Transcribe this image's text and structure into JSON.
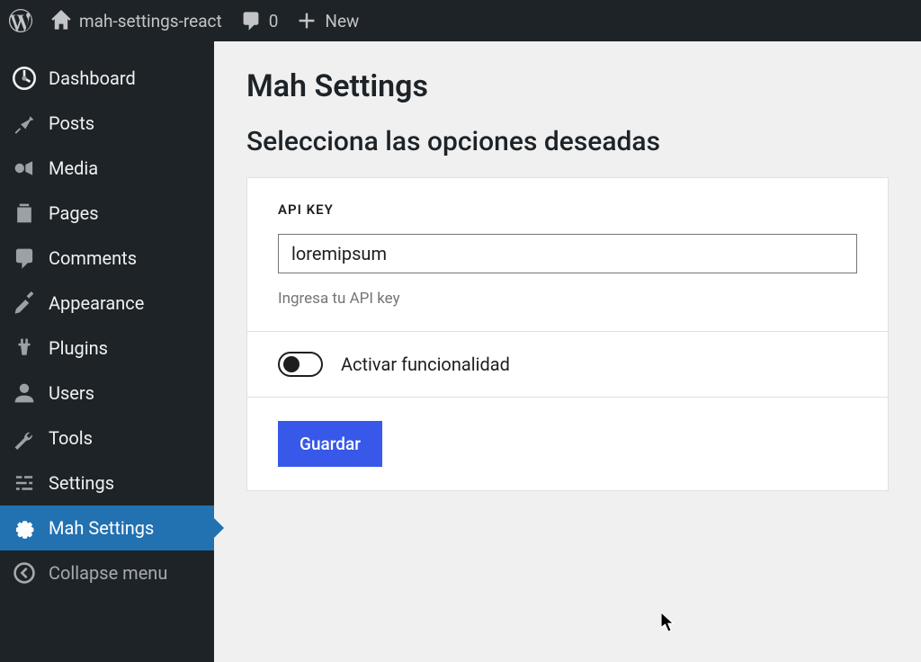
{
  "toolbar": {
    "site_name": "mah-settings-react",
    "comments_count": "0",
    "new_label": "New"
  },
  "sidebar": {
    "items": [
      {
        "label": "Dashboard",
        "icon": "dashboard"
      },
      {
        "label": "Posts",
        "icon": "pin"
      },
      {
        "label": "Media",
        "icon": "media"
      },
      {
        "label": "Pages",
        "icon": "pages"
      },
      {
        "label": "Comments",
        "icon": "comment"
      },
      {
        "label": "Appearance",
        "icon": "brush"
      },
      {
        "label": "Plugins",
        "icon": "plugin"
      },
      {
        "label": "Users",
        "icon": "user"
      },
      {
        "label": "Tools",
        "icon": "wrench"
      },
      {
        "label": "Settings",
        "icon": "sliders"
      },
      {
        "label": "Mah Settings",
        "icon": "gear",
        "active": true
      }
    ],
    "collapse_label": "Collapse menu"
  },
  "page": {
    "title": "Mah Settings",
    "subtitle": "Selecciona las opciones deseadas"
  },
  "form": {
    "api_key": {
      "label": "API KEY",
      "value": "loremipsum",
      "help": "Ingresa tu API key"
    },
    "toggle": {
      "label": "Activar funcionalidad"
    },
    "save_button": "Guardar"
  }
}
